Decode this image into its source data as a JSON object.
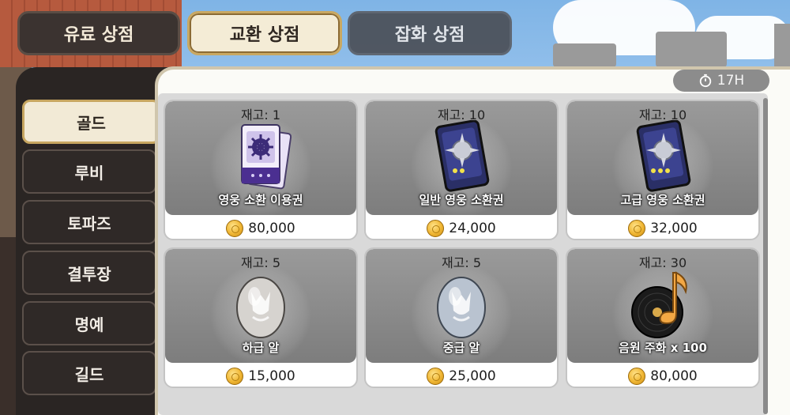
{
  "tabs": [
    {
      "label": "유료 상점"
    },
    {
      "label": "교환 상점"
    },
    {
      "label": "잡화 상점"
    }
  ],
  "active_tab": "교환 상점",
  "side_menu": [
    {
      "label": "골드"
    },
    {
      "label": "루비"
    },
    {
      "label": "토파즈"
    },
    {
      "label": "결투장"
    },
    {
      "label": "명예"
    },
    {
      "label": "길드"
    }
  ],
  "active_side": "골드",
  "timer": {
    "label": "17H",
    "icon": "stopwatch-icon"
  },
  "items": [
    {
      "stock": "재고: 1",
      "name": "영웅 소환 이용권",
      "price": "80,000",
      "icon": "hero-summon-ticket-icon"
    },
    {
      "stock": "재고: 10",
      "name": "일반 영웅 소환권",
      "price": "24,000",
      "icon": "normal-summon-card-icon"
    },
    {
      "stock": "재고: 10",
      "name": "고급 영웅 소환권",
      "price": "32,000",
      "icon": "premium-summon-card-icon"
    },
    {
      "stock": "재고: 5",
      "name": "하급 알",
      "price": "15,000",
      "icon": "low-egg-icon"
    },
    {
      "stock": "재고: 5",
      "name": "중급 알",
      "price": "25,000",
      "icon": "mid-egg-icon"
    },
    {
      "stock": "재고: 30",
      "name": "음원 주화 x 100",
      "price": "80,000",
      "icon": "music-record-icon"
    }
  ],
  "currency_icon": "gold-coin-icon",
  "colors": {
    "accent_gold": "#c9a862",
    "panel_dark": "#2a2523",
    "card_gray": "#8a8a8a"
  }
}
